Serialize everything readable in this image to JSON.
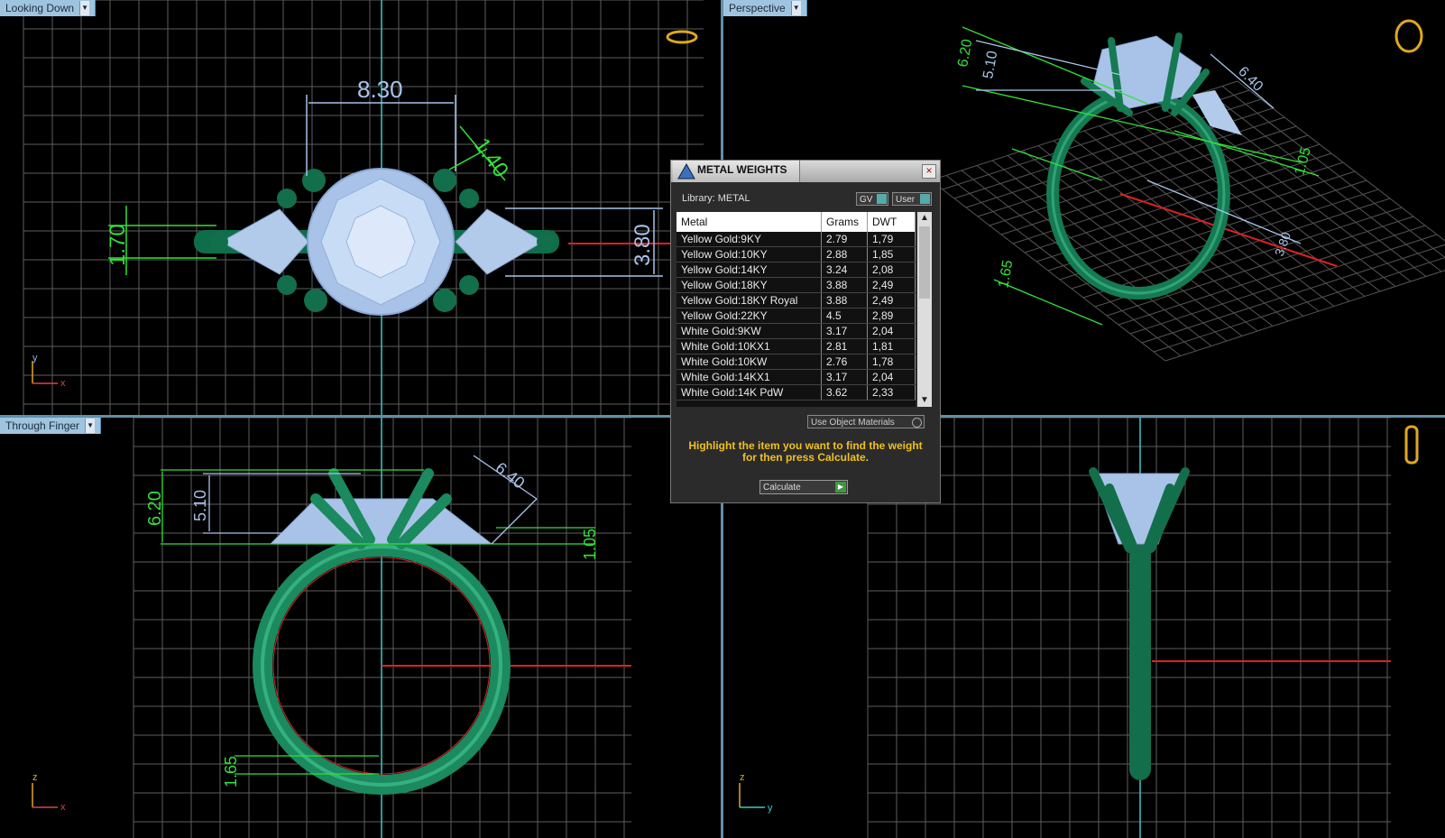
{
  "viewports": {
    "top_left": {
      "label": "Looking Down",
      "dims": {
        "width": "8.30",
        "prong": "1.40",
        "side_h": "1.70",
        "side_w": "3.80"
      }
    },
    "top_right": {
      "label": "Perspective",
      "dims": {
        "a": "6.20",
        "b": "5.10",
        "c": "6.40",
        "d": "1.05",
        "e": "1.65",
        "f": "3.80"
      }
    },
    "bottom_left": {
      "label": "Through Finger",
      "dims": {
        "height": "6.20",
        "crown": "5.10",
        "side": "6.40",
        "shoulder": "1.05",
        "band": "1.65"
      }
    },
    "bottom_right": {
      "label": ""
    }
  },
  "axes": {
    "x": "x",
    "y": "y",
    "z": "z"
  },
  "dialog": {
    "title": "METAL WEIGHTS",
    "close": "×",
    "library_label": "Library: METAL",
    "toggles": [
      "GV",
      "User"
    ],
    "columns": [
      "Metal",
      "Grams",
      "DWT"
    ],
    "rows": [
      {
        "metal": "Yellow Gold:9KY",
        "grams": "2.79",
        "dwt": "1,79"
      },
      {
        "metal": "Yellow Gold:10KY",
        "grams": "2.88",
        "dwt": "1,85"
      },
      {
        "metal": "Yellow Gold:14KY",
        "grams": "3.24",
        "dwt": "2,08"
      },
      {
        "metal": "Yellow Gold:18KY",
        "grams": "3.88",
        "dwt": "2,49"
      },
      {
        "metal": "Yellow Gold:18KY Royal",
        "grams": "3.88",
        "dwt": "2,49"
      },
      {
        "metal": "Yellow Gold:22KY",
        "grams": "4.5",
        "dwt": "2,89"
      },
      {
        "metal": "White Gold:9KW",
        "grams": "3.17",
        "dwt": "2,04"
      },
      {
        "metal": "White Gold:10KX1",
        "grams": "2.81",
        "dwt": "1,81"
      },
      {
        "metal": "White Gold:10KW",
        "grams": "2.76",
        "dwt": "1,78"
      },
      {
        "metal": "White Gold:14KX1",
        "grams": "3.17",
        "dwt": "2,04"
      },
      {
        "metal": "White Gold:14K PdW",
        "grams": "3.62",
        "dwt": "2,33"
      }
    ],
    "use_object_materials": "Use Object Materials",
    "hint": "Highlight the item you want to find the weight for then press Calculate.",
    "calculate": "Calculate"
  },
  "colors": {
    "metal": "#1b8a5e",
    "stone": "#a9c3e8",
    "dim_green": "#33e03a",
    "dim_blue": "#a9c3e8",
    "grid": "#6a6a6a",
    "axis_red": "#d22",
    "axis_cyan": "#3cc8c8"
  }
}
